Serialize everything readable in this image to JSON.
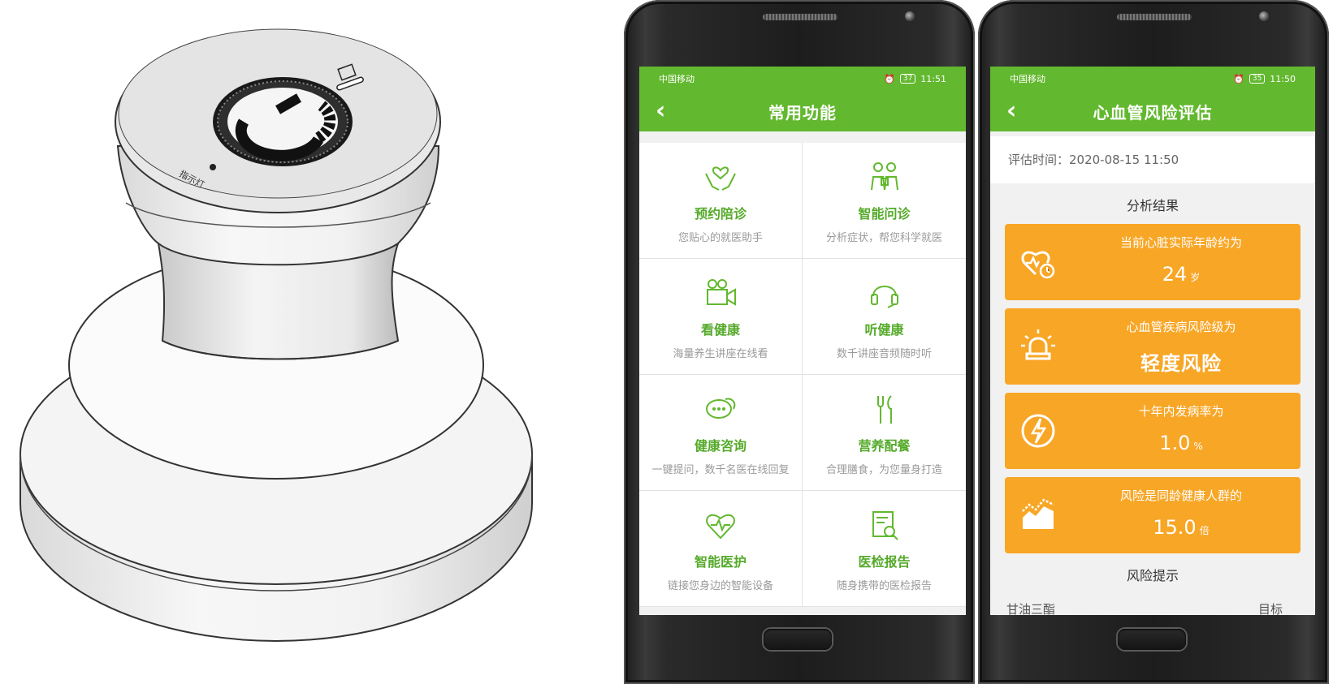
{
  "device": {
    "indicator_label": "指示灯"
  },
  "phone1": {
    "status": {
      "carrier": "中国移动",
      "battery": "37",
      "time": "11:51"
    },
    "title": "常用功能",
    "functions": [
      {
        "name": "预约陪诊",
        "desc": "您贴心的就医助手",
        "icon": "hands-heart-icon"
      },
      {
        "name": "智能问诊",
        "desc": "分析症状，帮您科学就医",
        "icon": "doctor-consult-icon"
      },
      {
        "name": "看健康",
        "desc": "海量养生讲座在线看",
        "icon": "video-camera-icon"
      },
      {
        "name": "听健康",
        "desc": "数千讲座音频随时听",
        "icon": "headphones-icon"
      },
      {
        "name": "健康咨询",
        "desc": "一键提问，数千名医在线回复",
        "icon": "chat-bubbles-icon"
      },
      {
        "name": "营养配餐",
        "desc": "合理膳食，为您量身打造",
        "icon": "fork-knife-icon"
      },
      {
        "name": "智能医护",
        "desc": "链接您身边的智能设备",
        "icon": "heart-pulse-icon"
      },
      {
        "name": "医检报告",
        "desc": "随身携带的医检报告",
        "icon": "report-search-icon"
      }
    ]
  },
  "phone2": {
    "status": {
      "carrier": "中国移动",
      "battery": "35",
      "time": "11:50"
    },
    "title": "心血管风险评估",
    "eval_time": "评估时间：2020-08-15 11:50",
    "section_title": "分析结果",
    "cards": [
      {
        "label": "当前心脏实际年龄约为",
        "value": "24",
        "unit": "岁",
        "icon": "heart-clock-icon"
      },
      {
        "label": "心血管疾病风险级为",
        "value": "轻度风险",
        "unit": "",
        "icon": "alarm-light-icon"
      },
      {
        "label": "十年内发病率为",
        "value": "1.0",
        "unit": "%",
        "icon": "lightning-icon"
      },
      {
        "label": "风险是同龄健康人群的",
        "value": "15.0",
        "unit": "倍",
        "icon": "trend-chart-icon"
      }
    ],
    "hint_title": "风险提示",
    "cut_left": "甘油三酯",
    "cut_right": "目标"
  },
  "colors": {
    "green": "#62b82e",
    "orange": "#f8a626"
  }
}
